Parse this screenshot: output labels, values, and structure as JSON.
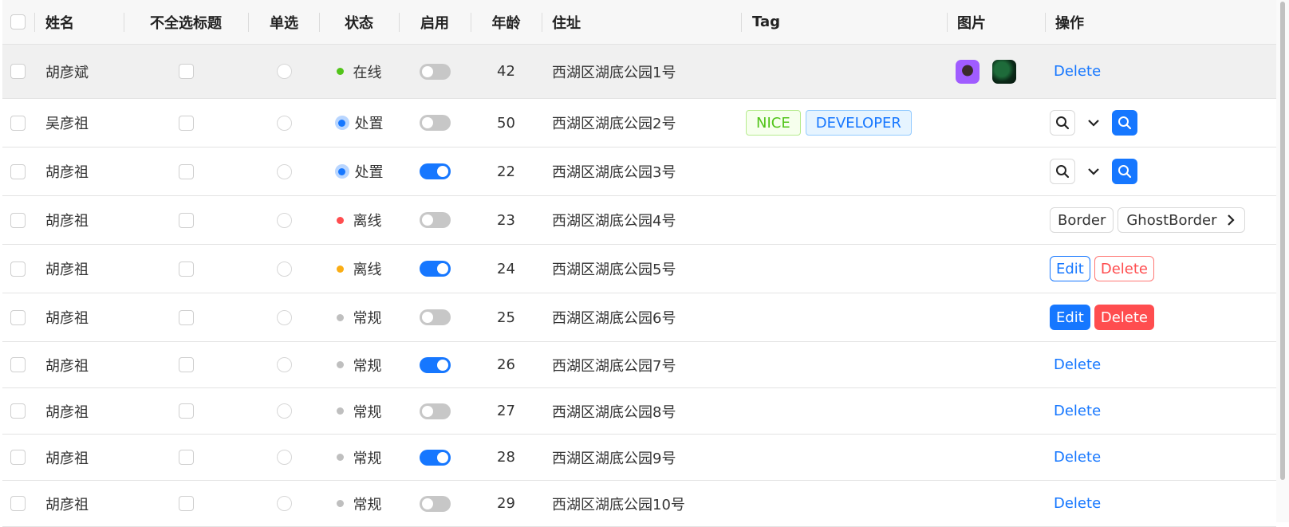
{
  "columns": {
    "name": "姓名",
    "partial": "不全选标题",
    "radio": "单选",
    "status": "状态",
    "enabled": "启用",
    "age": "年龄",
    "address": "住址",
    "tag": "Tag",
    "image": "图片",
    "action": "操作"
  },
  "colors": {
    "online": "#52c41a",
    "offline_red": "#ff4d4f",
    "offline_orange": "#faad14",
    "normal": "#bfbfbf",
    "primary": "#1677ff"
  },
  "rows": [
    {
      "name": "胡彦斌",
      "status": "在线",
      "age": "42",
      "address": "西湖区湖底公园1号",
      "enabled": false,
      "action": "Delete"
    },
    {
      "name": "吴彦祖",
      "status": "处置",
      "age": "50",
      "address": "西湖区湖底公园2号",
      "enabled": false,
      "tags": [
        "NICE",
        "DEVELOPER"
      ]
    },
    {
      "name": "胡彦祖",
      "status": "处置",
      "age": "22",
      "address": "西湖区湖底公园3号",
      "enabled": true
    },
    {
      "name": "胡彦祖",
      "status": "离线",
      "age": "23",
      "address": "西湖区湖底公园4号",
      "enabled": false,
      "btn1": "Border",
      "btn2": "GhostBorder"
    },
    {
      "name": "胡彦祖",
      "status": "离线",
      "age": "24",
      "address": "西湖区湖底公园5号",
      "enabled": true,
      "btn1": "Edit",
      "btn2": "Delete"
    },
    {
      "name": "胡彦祖",
      "status": "常规",
      "age": "25",
      "address": "西湖区湖底公园6号",
      "enabled": false,
      "btn1": "Edit",
      "btn2": "Delete"
    },
    {
      "name": "胡彦祖",
      "status": "常规",
      "age": "26",
      "address": "西湖区湖底公园7号",
      "enabled": true,
      "action": "Delete"
    },
    {
      "name": "胡彦祖",
      "status": "常规",
      "age": "27",
      "address": "西湖区湖底公园8号",
      "enabled": false,
      "action": "Delete"
    },
    {
      "name": "胡彦祖",
      "status": "常规",
      "age": "28",
      "address": "西湖区湖底公园9号",
      "enabled": true,
      "action": "Delete"
    },
    {
      "name": "胡彦祖",
      "status": "常规",
      "age": "29",
      "address": "西湖区湖底公园10号",
      "enabled": false,
      "action": "Delete"
    }
  ]
}
